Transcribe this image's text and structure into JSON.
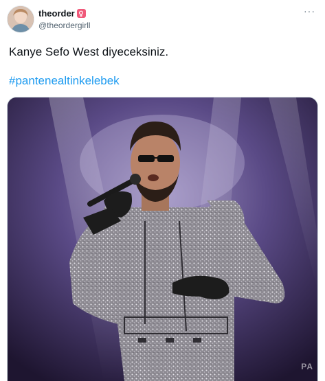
{
  "user": {
    "display_name": "theorder",
    "handle": "@theordergirll",
    "badge_icon": "female-sign-icon",
    "badge_color": "#f0597a"
  },
  "menu": {
    "more_label": "···"
  },
  "tweet": {
    "text": "Kanye Sefo West diyeceksiniz.",
    "hashtag": "#pantenealtinkelebek",
    "hashtag_color": "#1d9bf0"
  },
  "media": {
    "watermark": "PA"
  }
}
